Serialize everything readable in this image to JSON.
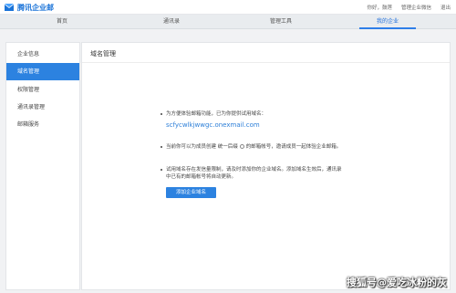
{
  "brand": {
    "name": "腾讯企业邮",
    "accent": "#2c82e0"
  },
  "top_links": {
    "greeting": "你好，鼓莲",
    "admin_manual": "管理企业微信",
    "logout": "退出"
  },
  "nav": {
    "items": [
      {
        "label": "首页"
      },
      {
        "label": "通讯录"
      },
      {
        "label": "管理工具"
      },
      {
        "label": "我的企业",
        "active": true
      }
    ]
  },
  "sidebar": {
    "items": [
      {
        "label": "企业信息"
      },
      {
        "label": "域名管理",
        "active": true
      },
      {
        "label": "权限管理"
      },
      {
        "label": "通讯录管理"
      },
      {
        "label": "邮箱服务"
      }
    ]
  },
  "main": {
    "title": "域名管理",
    "line1": "为方便体验邮箱功能，已为你提供试用域名：",
    "domain": "scfycwlkjwwgc.onexmail.com",
    "line2_a": "当前你可以为成员创建 统一后缀",
    "line2_b": "的邮箱帐号，邀请成员一起体验企业邮箱。",
    "line3_a": "试用域名存在发信量限制，请及时添加你的企业域名。添加域名生效后，通讯录",
    "line3_b": "中已有的邮箱帐号将自动更新。",
    "add_button": "添加企业域名"
  },
  "watermark": "搜狐号@爱吃冰粉的灰"
}
